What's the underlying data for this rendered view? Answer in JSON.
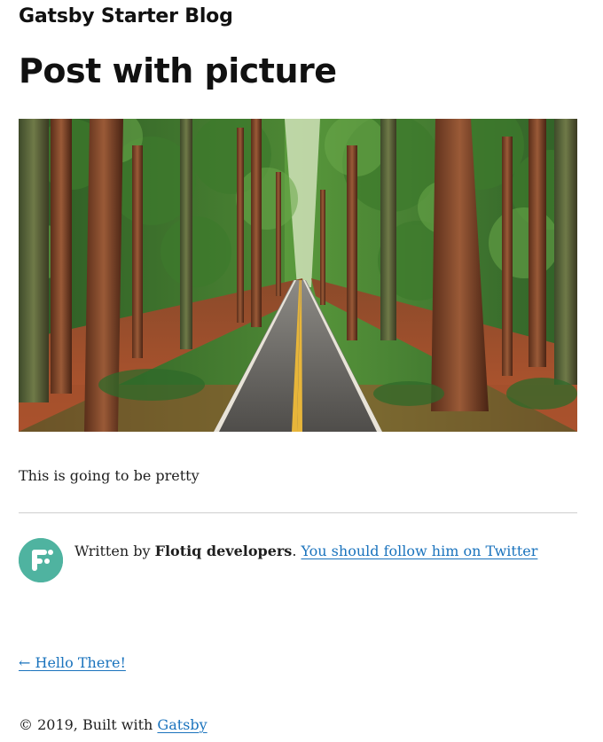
{
  "header": {
    "site_title": "Gatsby Starter Blog"
  },
  "post": {
    "title": "Post with picture",
    "body": "This is going to be pretty"
  },
  "bio": {
    "prefix": "Written by ",
    "author": "Flotiq developers",
    "separator": ". ",
    "twitter_link": "You should follow him on Twitter",
    "avatar_icon": "flotiq-logo-icon"
  },
  "navigation": {
    "previous_arrow": "←",
    "previous_title": "Hello There!"
  },
  "footer": {
    "copyright": "© 2019, Built with ",
    "gatsby_link": "Gatsby"
  },
  "colors": {
    "link": "#1a73bd",
    "divider": "#cfcfcf",
    "avatar_gradient_start": "#5bc7a7",
    "avatar_gradient_end": "#3f9f98"
  }
}
